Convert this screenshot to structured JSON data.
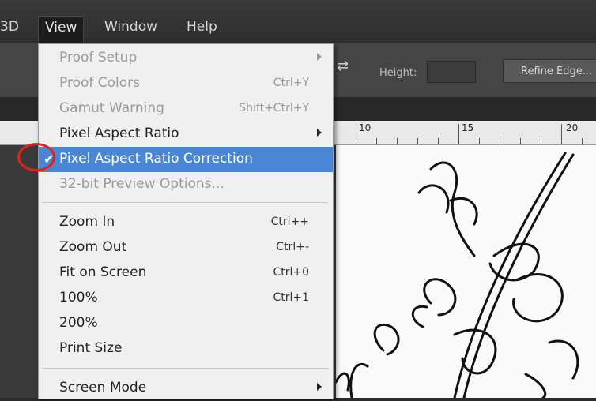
{
  "menubar": {
    "items": [
      {
        "label": "3D"
      },
      {
        "label": "View",
        "active": true
      },
      {
        "label": "Window"
      },
      {
        "label": "Help"
      }
    ]
  },
  "options_bar": {
    "height_label": "Height:",
    "refine_button": "Refine Edge..."
  },
  "ruler": {
    "numbers": [
      "10",
      "15",
      "20"
    ]
  },
  "view_menu": {
    "items": [
      {
        "label": "Proof Setup",
        "shortcut": "",
        "submenu": true,
        "enabled": false
      },
      {
        "label": "Proof Colors",
        "shortcut": "Ctrl+Y",
        "enabled": false
      },
      {
        "label": "Gamut Warning",
        "shortcut": "Shift+Ctrl+Y",
        "enabled": false
      },
      {
        "label": "Pixel Aspect Ratio",
        "shortcut": "",
        "submenu": true,
        "enabled": true
      },
      {
        "label": "Pixel Aspect Ratio Correction",
        "shortcut": "",
        "enabled": true,
        "checked": true,
        "highlighted": true
      },
      {
        "label": "32-bit Preview Options...",
        "shortcut": "",
        "enabled": false
      },
      {
        "label": "Zoom In",
        "shortcut": "Ctrl++",
        "enabled": true
      },
      {
        "label": "Zoom Out",
        "shortcut": "Ctrl+-",
        "enabled": true
      },
      {
        "label": "Fit on Screen",
        "shortcut": "Ctrl+0",
        "enabled": true
      },
      {
        "label": "100%",
        "shortcut": "Ctrl+1",
        "enabled": true
      },
      {
        "label": "200%",
        "shortcut": "",
        "enabled": true
      },
      {
        "label": "Print Size",
        "shortcut": "",
        "enabled": true
      },
      {
        "label": "Screen Mode",
        "shortcut": "",
        "submenu": true,
        "enabled": true
      }
    ]
  },
  "colors": {
    "highlight": "#4a86d4",
    "annotation_circle": "#e2231a"
  }
}
